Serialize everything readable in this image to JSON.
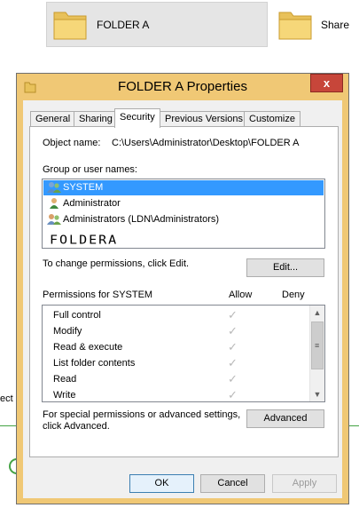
{
  "background": {
    "folder_label": "FOLDER A",
    "share_label": "Share",
    "cut_text": "ect"
  },
  "dialog": {
    "title": "FOLDER A Properties",
    "close_glyph": "x",
    "tabs": [
      {
        "label": "General"
      },
      {
        "label": "Sharing"
      },
      {
        "label": "Security"
      },
      {
        "label": "Previous Versions"
      },
      {
        "label": "Customize"
      }
    ],
    "object_name_label": "Object name:",
    "object_name_value": "C:\\Users\\Administrator\\Desktop\\FOLDER A",
    "group_label": "Group or user names:",
    "users": [
      {
        "name": "SYSTEM",
        "icon": "users-group-icon",
        "selected": true
      },
      {
        "name": "Administrator",
        "icon": "user-icon",
        "selected": false
      },
      {
        "name": "Administrators (LDN\\Administrators)",
        "icon": "users-group-icon",
        "selected": false
      }
    ],
    "handwritten_text": "FOLDERA",
    "change_permissions_text": "To change permissions, click Edit.",
    "edit_button": "Edit...",
    "permissions_header": "Permissions for SYSTEM",
    "allow_header": "Allow",
    "deny_header": "Deny",
    "permissions": [
      {
        "name": "Full control",
        "allow": true,
        "deny": false
      },
      {
        "name": "Modify",
        "allow": true,
        "deny": false
      },
      {
        "name": "Read & execute",
        "allow": true,
        "deny": false
      },
      {
        "name": "List folder contents",
        "allow": true,
        "deny": false
      },
      {
        "name": "Read",
        "allow": true,
        "deny": false
      },
      {
        "name": "Write",
        "allow": true,
        "deny": false
      }
    ],
    "check_glyph": "✓",
    "special_text_line1": "For special permissions or advanced settings,",
    "special_text_line2": "click Advanced.",
    "advanced_button": "Advanced",
    "ok_button": "OK",
    "cancel_button": "Cancel",
    "apply_button": "Apply"
  },
  "colors": {
    "title_frame": "#f0c875",
    "close_button": "#c7463a",
    "selection": "#3399ff"
  }
}
